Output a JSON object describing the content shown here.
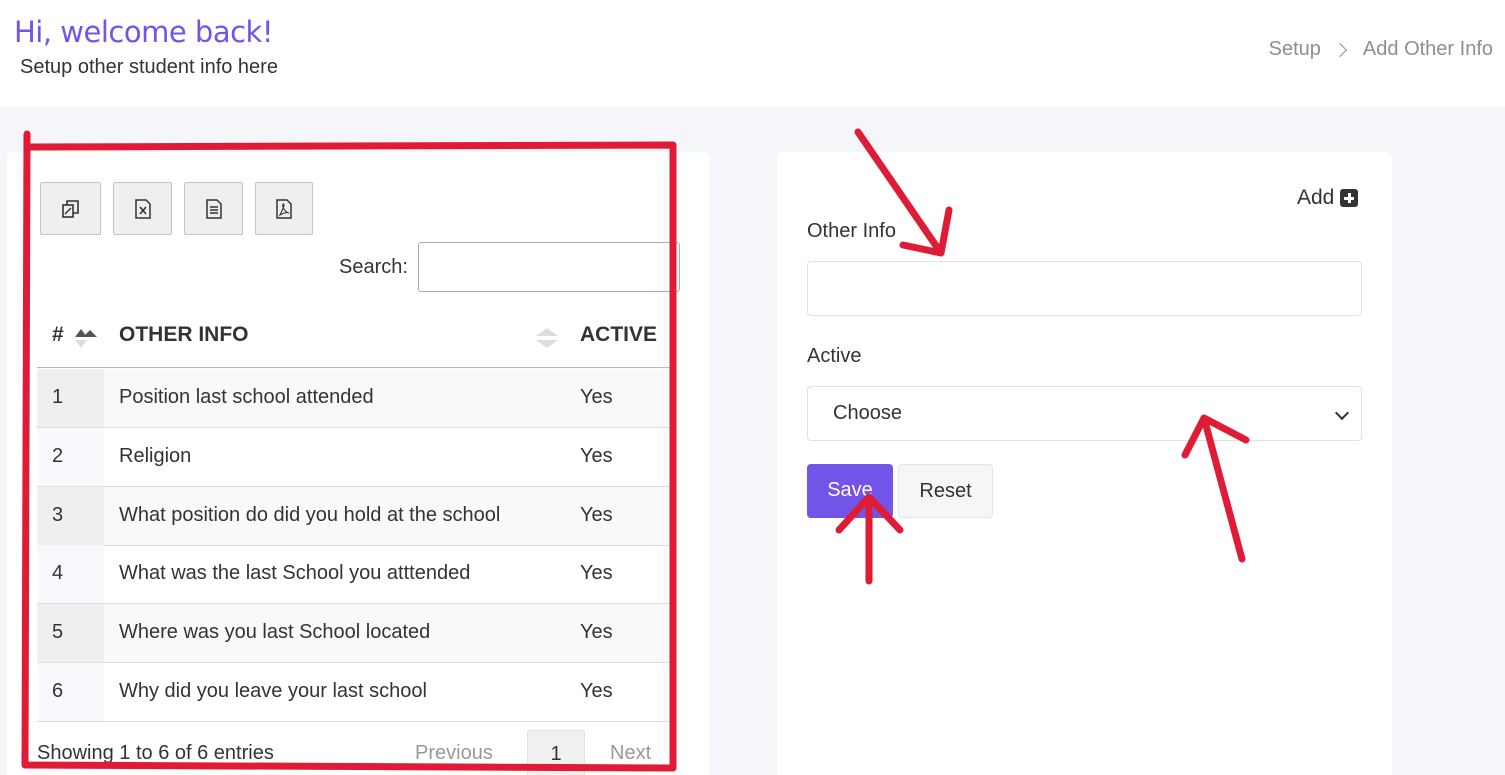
{
  "header": {
    "greeting": "Hi, welcome back!",
    "subtitle": "Setup other student info here"
  },
  "breadcrumb": {
    "items": [
      "Setup",
      "Add Other Info"
    ]
  },
  "table_panel": {
    "export_buttons": [
      "copy-icon",
      "excel-icon",
      "csv-icon",
      "pdf-icon"
    ],
    "search_label": "Search:",
    "search_value": "",
    "columns": [
      "#",
      "OTHER INFO",
      "ACTIVE"
    ],
    "rows": [
      {
        "num": "1",
        "info": "Position last school attended",
        "active": "Yes"
      },
      {
        "num": "2",
        "info": "Religion",
        "active": "Yes"
      },
      {
        "num": "3",
        "info": "What position do did you hold at the school",
        "active": "Yes"
      },
      {
        "num": "4",
        "info": "What was the last School you atttended",
        "active": "Yes"
      },
      {
        "num": "5",
        "info": "Where was you last School located",
        "active": "Yes"
      },
      {
        "num": "6",
        "info": "Why did you leave your last school",
        "active": "Yes"
      }
    ],
    "footer_info": "Showing 1 to 6 of 6 entries",
    "pagination": {
      "previous": "Previous",
      "current": "1",
      "next": "Next"
    }
  },
  "form_panel": {
    "add_label": "Add",
    "other_info_label": "Other Info",
    "other_info_value": "",
    "active_label": "Active",
    "active_selected": "Choose",
    "save_label": "Save",
    "reset_label": "Reset"
  },
  "colors": {
    "accent": "#7254e8",
    "annotation": "#e01b35"
  }
}
